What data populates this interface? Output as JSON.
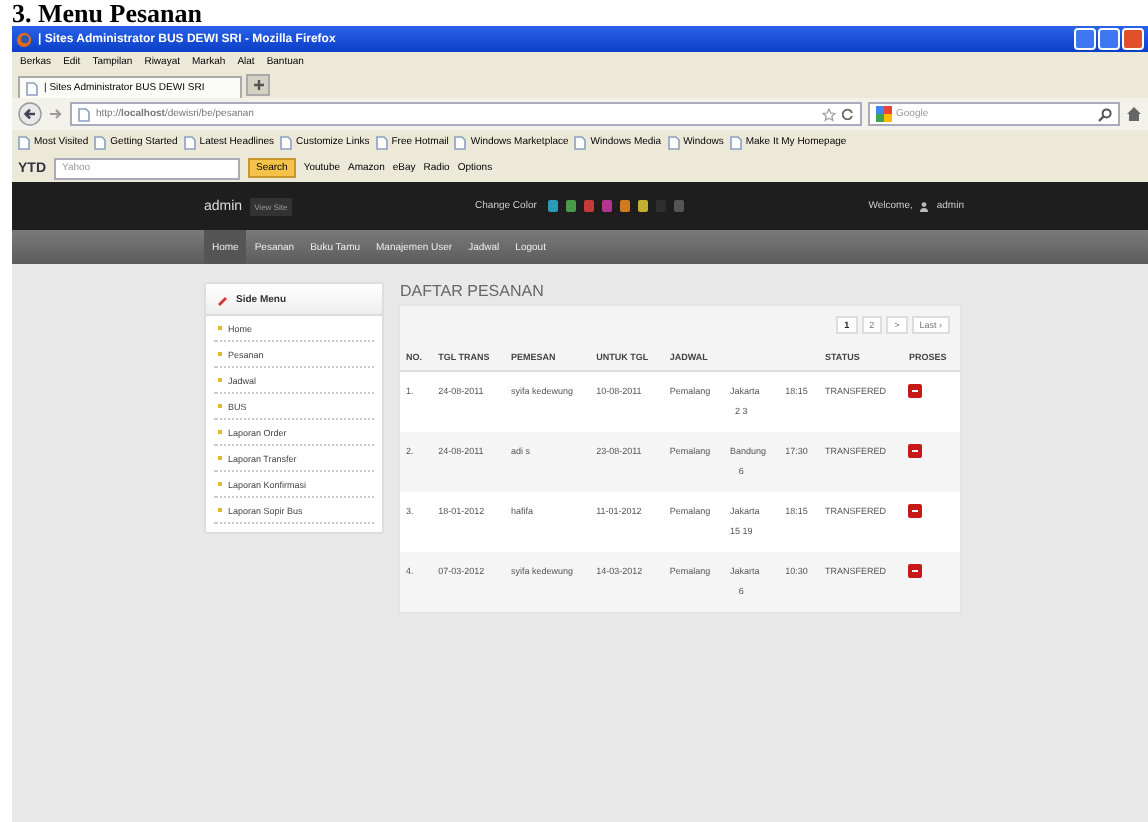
{
  "document_heading": "3. Menu Pesanan",
  "window": {
    "title": "| Sites Administrator BUS DEWI SRI - Mozilla Firefox"
  },
  "menu_bar": [
    "Berkas",
    "Edit",
    "Tampilan",
    "Riwayat",
    "Markah",
    "Alat",
    "Bantuan"
  ],
  "tabs": [
    {
      "label": "| Sites Administrator BUS DEWI SRI",
      "selected": true
    }
  ],
  "address": {
    "value": "http://**localhost**/dewisri/be/pesanan"
  },
  "search": {
    "placeholder": "Google"
  },
  "bookmarks": [
    "Most Visited",
    "Getting Started",
    "Latest Headlines",
    "Customize Links",
    "Free Hotmail",
    "Windows Marketplace",
    "Windows Media",
    "Windows",
    "Make It My Homepage"
  ],
  "toolbar": {
    "brand": "YTD",
    "search_placeholder": "Yahoo",
    "search_button": "Search",
    "links": [
      "Youtube",
      "Amazon",
      "eBay",
      "Radio"
    ],
    "options": "Options"
  },
  "site_header": {
    "brand": "admin",
    "view_site": "View Site",
    "change_color_label": "Change Color",
    "welcome": "Welcome,",
    "user": "admin",
    "colors": [
      {
        "color": "#2a9bb5"
      },
      {
        "color": "#4a9a4a"
      },
      {
        "color": "#c83a3a"
      },
      {
        "color": "#b0368e"
      },
      {
        "color": "#d07a20"
      },
      {
        "color": "#c4b030"
      },
      {
        "color": "#2e2e2e"
      },
      {
        "color": "#555555"
      }
    ]
  },
  "nav": [
    {
      "label": "Home",
      "selected": true
    },
    {
      "label": "Pesanan",
      "selected": false
    },
    {
      "label": "Buku Tamu",
      "selected": false
    },
    {
      "label": "Manajemen User",
      "selected": false
    },
    {
      "label": "Jadwal",
      "selected": false
    },
    {
      "label": "Logout",
      "selected": false
    }
  ],
  "side_menu": {
    "title": "Side Menu",
    "items": [
      "Home",
      "Pesanan",
      "Jadwal",
      "BUS",
      "Laporan Order",
      "Laporan Transfer",
      "Laporan Konfirmasi",
      "Laporan Sopir Bus"
    ]
  },
  "orders": {
    "title": "DAFTAR PESANAN",
    "pagination": [
      {
        "label": "1",
        "selected": true
      },
      {
        "label": "2",
        "selected": false
      },
      {
        "label": ">",
        "selected": false
      },
      {
        "label": "Last ›",
        "selected": false
      }
    ],
    "columns": [
      "NO.",
      "TGL TRANS",
      "PEMESAN",
      "UNTUK TGL",
      "JADWAL",
      "STATUS",
      "PROSES"
    ],
    "rows": [
      {
        "no": "1.",
        "tgl_trans": "24-08-2011",
        "pemesan": "syifa kedewung",
        "untuk_tgl": "10-08-2011",
        "jadwal": [
          "Pemalang",
          "Jakarta",
          "18:15"
        ],
        "seat": "2 3",
        "status": "TRANSFERED"
      },
      {
        "no": "2.",
        "tgl_trans": "24-08-2011",
        "pemesan": "adi s",
        "untuk_tgl": "23-08-2011",
        "jadwal": [
          "Pemalang",
          "Bandung",
          "17:30"
        ],
        "seat": "6",
        "status": "TRANSFERED"
      },
      {
        "no": "3.",
        "tgl_trans": "18-01-2012",
        "pemesan": "hafifa",
        "untuk_tgl": "11-01-2012",
        "jadwal": [
          "Pemalang",
          "Jakarta",
          "18:15"
        ],
        "seat": "15 19",
        "status": "TRANSFERED"
      },
      {
        "no": "4.",
        "tgl_trans": "07-03-2012",
        "pemesan": "syifa kedewung",
        "untuk_tgl": "14-03-2012",
        "jadwal": [
          "Pemalang",
          "Jakarta",
          "10:30"
        ],
        "seat": "6",
        "status": "TRANSFERED"
      }
    ]
  }
}
